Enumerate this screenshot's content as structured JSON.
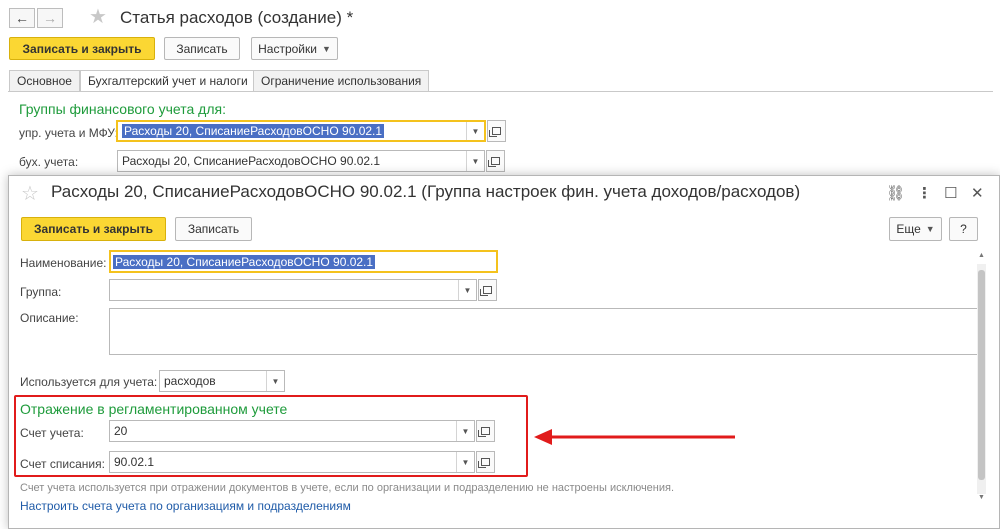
{
  "back_window": {
    "title": "Статья расходов (создание) *",
    "nav": {
      "back": "←",
      "forward": "→"
    },
    "toolbar": {
      "save_close": "Записать и закрыть",
      "save": "Записать",
      "settings": "Настройки"
    },
    "tabs": [
      {
        "label": "Основное"
      },
      {
        "label": "Бухгалтерский учет и налоги",
        "active": true
      },
      {
        "label": "Ограничение использования"
      }
    ],
    "group_title": "Группы финансового учета для:",
    "fields": [
      {
        "label": "упр. учета и МФУ:",
        "value": "Расходы 20, СписаниеРасходовОСНО 90.02.1"
      },
      {
        "label": "бух. учета:",
        "value": "Расходы 20, СписаниеРасходовОСНО 90.02.1"
      }
    ]
  },
  "dialog": {
    "title": "Расходы 20, СписаниеРасходовОСНО 90.02.1 (Группа настроек фин. учета доходов/расходов)",
    "toolbar": {
      "save_close": "Записать и закрыть",
      "save": "Записать",
      "more": "Еще",
      "help": "?"
    },
    "name_label": "Наименование:",
    "name_value": "Расходы 20, СписаниеРасходовОСНО 90.02.1",
    "group_label": "Группа:",
    "group_value": "",
    "description_label": "Описание:",
    "used_for_label": "Используется для учета:",
    "used_for_value": "расходов",
    "section_title": "Отражение в регламентированном учете",
    "account_label": "Счет учета:",
    "account_value": "20",
    "writeoff_label": "Счет списания:",
    "writeoff_value": "90.02.1",
    "hint": "Счет учета используется при отражении документов в учете, если по организации и подразделению не настроены исключения.",
    "link": "Настроить счета учета по организациям и подразделениям"
  },
  "colors": {
    "primary_button": "#fbd733",
    "group_title": "#1e9b3b",
    "highlight_box": "#e11b1b",
    "link": "#1f5ba8"
  },
  "icons": [
    "arrow-left-icon",
    "arrow-right-icon",
    "star-icon",
    "link-icon",
    "more-vert-icon",
    "maximize-icon",
    "close-icon",
    "open-form-icon",
    "dropdown-icon"
  ]
}
